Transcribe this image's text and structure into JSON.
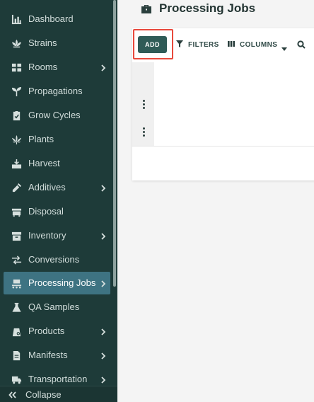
{
  "sidebar": {
    "items": [
      {
        "label": "Dashboard",
        "icon": "chart-bar-icon",
        "has_children": false,
        "active": false
      },
      {
        "label": "Strains",
        "icon": "lotus-icon",
        "has_children": false,
        "active": false
      },
      {
        "label": "Rooms",
        "icon": "grid-icon",
        "has_children": true,
        "active": false
      },
      {
        "label": "Propagations",
        "icon": "sprout-icon",
        "has_children": false,
        "active": false
      },
      {
        "label": "Grow Cycles",
        "icon": "clipboard-check-icon",
        "has_children": false,
        "active": false
      },
      {
        "label": "Plants",
        "icon": "cannabis-leaf-icon",
        "has_children": false,
        "active": false
      },
      {
        "label": "Harvest",
        "icon": "harvest-tray-icon",
        "has_children": false,
        "active": false
      },
      {
        "label": "Additives",
        "icon": "dropper-icon",
        "has_children": true,
        "active": false
      },
      {
        "label": "Disposal",
        "icon": "dumpster-icon",
        "has_children": false,
        "active": false
      },
      {
        "label": "Inventory",
        "icon": "archive-box-icon",
        "has_children": true,
        "active": false
      },
      {
        "label": "Conversions",
        "icon": "exchange-arrows-icon",
        "has_children": false,
        "active": false
      },
      {
        "label": "Processing Jobs",
        "icon": "conveyor-icon",
        "has_children": true,
        "active": true
      },
      {
        "label": "QA Samples",
        "icon": "flask-icon",
        "has_children": false,
        "active": false
      },
      {
        "label": "Products",
        "icon": "product-bag-icon",
        "has_children": true,
        "active": false
      },
      {
        "label": "Manifests",
        "icon": "document-icon",
        "has_children": true,
        "active": false
      },
      {
        "label": "Transportation",
        "icon": "truck-icon",
        "has_children": true,
        "active": false
      }
    ],
    "collapse_label": "Collapse"
  },
  "main": {
    "title": "Processing Jobs",
    "title_icon": "briefcase-icon",
    "toolbar": {
      "add_label": "ADD",
      "filters_label": "FILTERS",
      "columns_label": "COLUMNS"
    }
  },
  "colors": {
    "sidebar_bg": "#1e3b39",
    "active_item_bg": "#3e7382",
    "add_button_bg": "#2f5b57",
    "highlight_border": "#e8493c"
  }
}
